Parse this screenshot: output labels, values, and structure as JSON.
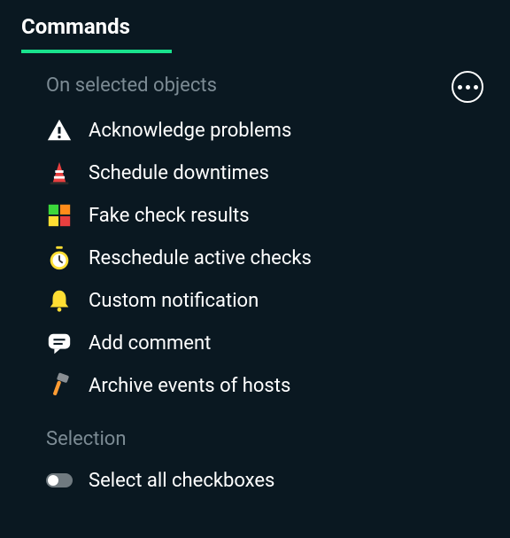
{
  "tab": {
    "label": "Commands"
  },
  "sections": {
    "actions_header": "On selected objects",
    "selection_header": "Selection"
  },
  "actions": {
    "acknowledge": "Acknowledge problems",
    "downtimes": "Schedule downtimes",
    "fake_check": "Fake check results",
    "reschedule": "Reschedule active checks",
    "notification": "Custom notification",
    "comment": "Add comment",
    "archive": "Archive events of hosts"
  },
  "selection": {
    "select_all": "Select all checkboxes"
  }
}
